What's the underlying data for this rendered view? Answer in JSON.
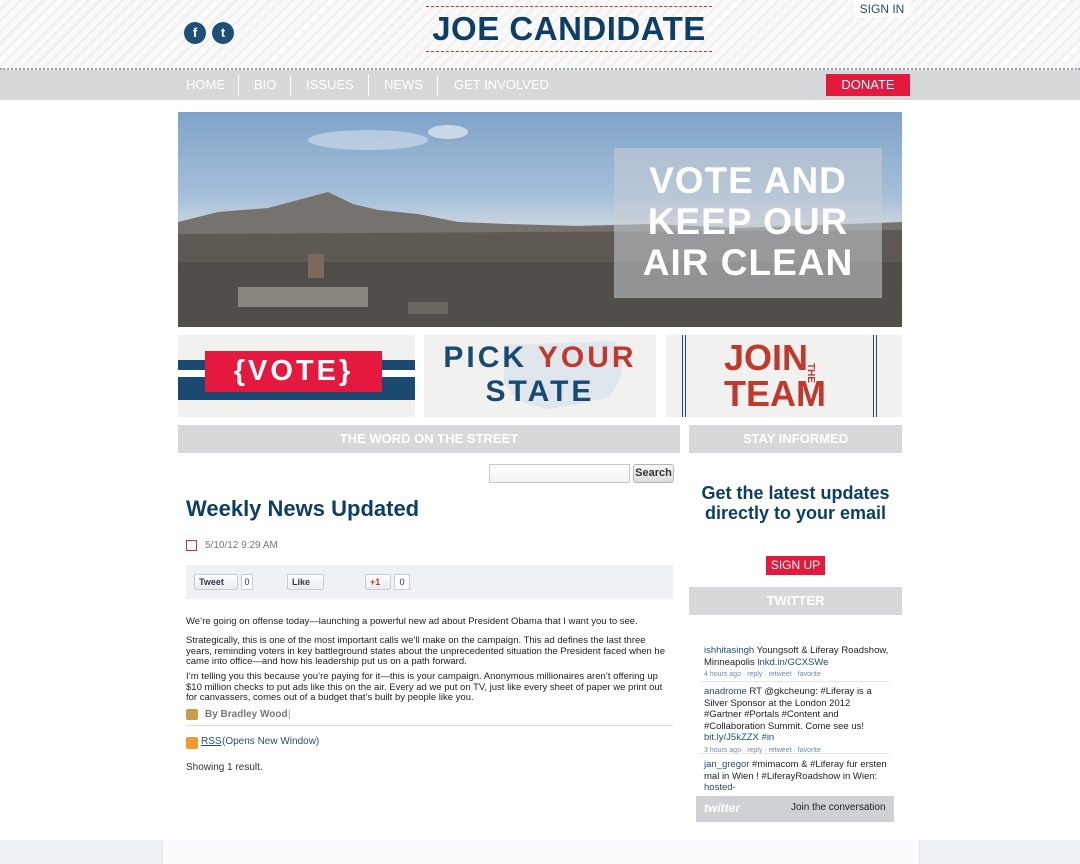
{
  "header": {
    "site_title": "JOE CANDIDATE",
    "sign_in": "SIGN IN",
    "social": [
      {
        "icon": "facebook-icon",
        "glyph": "f"
      },
      {
        "icon": "twitter-icon",
        "glyph": "t"
      }
    ]
  },
  "nav": {
    "items": [
      "HOME",
      "BIO",
      "ISSUES",
      "NEWS",
      "GET INVOLVED"
    ],
    "donate": "DONATE"
  },
  "hero": {
    "line1": "VOTE AND",
    "line2": "KEEP OUR",
    "line3": "AIR CLEAN"
  },
  "promos": {
    "vote": "{VOTE}",
    "pick_state_line1_a": "PICK ",
    "pick_state_line1_b": "YOUR",
    "pick_state_line2": "STATE",
    "join": "JOIN",
    "the": "THE",
    "team": "TEAM"
  },
  "main": {
    "section_title": "THE WORD ON THE STREET",
    "search": {
      "placeholder": "",
      "button": "Search"
    },
    "post": {
      "title": "Weekly News Updated",
      "date": "5/10/12 9:29 AM",
      "share": {
        "tweet": "Tweet",
        "tweet_count": "0",
        "like": "Like",
        "plus": "+1",
        "plus_count": "0"
      },
      "paragraphs": [
        "We’re going on offense today—launching a powerful new ad about President Obama that I want you to see.",
        "Strategically, this is one of the most important calls we’ll make on the campaign. This ad defines the last three years, reminding voters in key battleground states about the unprecedented situation the President faced when he came into office—and how his leadership put us on a path forward.",
        "I’m telling you this because you’re paying for it—this is your campaign. Anonymous millionaires aren’t offering up $10 million checks to put ads like this on the air. Every ad we put on TV, just like every sheet of paper we print out for canvassers, comes out of a budget that’s built by people like you."
      ],
      "byline": "By Bradley Wood",
      "byline_sep": "|"
    },
    "rss_label": "RSS",
    "rss_note": " (Opens New Window)",
    "results": "Showing 1 result."
  },
  "sidebar": {
    "stay_informed": "STAY INFORMED",
    "promo": "Get the latest updates directly to your email",
    "signup": "SIGN UP",
    "twitter_title": "TWITTER",
    "tweets": [
      {
        "user": "ishhitasingh",
        "text": " Youngsoft & Liferay Roadshow, Minneapolis ",
        "link": "lnkd.in/GCXSWe",
        "meta": "4 hours ago · reply · retweet · favorite"
      },
      {
        "user": "anadrome",
        "text": " RT @gkcheung: #Liferay is a Silver Sponsor at the London 2012 #Gartner #Portals #Content and #Collaboration Summit. Come see us! ",
        "link": "bit.ly/J5kZZX #in",
        "meta": "3 hours ago · reply · retweet · favorite"
      },
      {
        "user": "jan_gregor",
        "text": " #mimacom & #Liferay fur ersten mal in Wien ! #LiferayRoadshow in Wien: ",
        "link": "hosted-",
        "meta": ""
      }
    ],
    "twitter_logo": "twitter",
    "join_conversation": "Join the conversation"
  },
  "colors": {
    "brand_blue": "#0e3e66",
    "accent_red": "#e5183d",
    "nav_gray": "#d7d8da"
  }
}
